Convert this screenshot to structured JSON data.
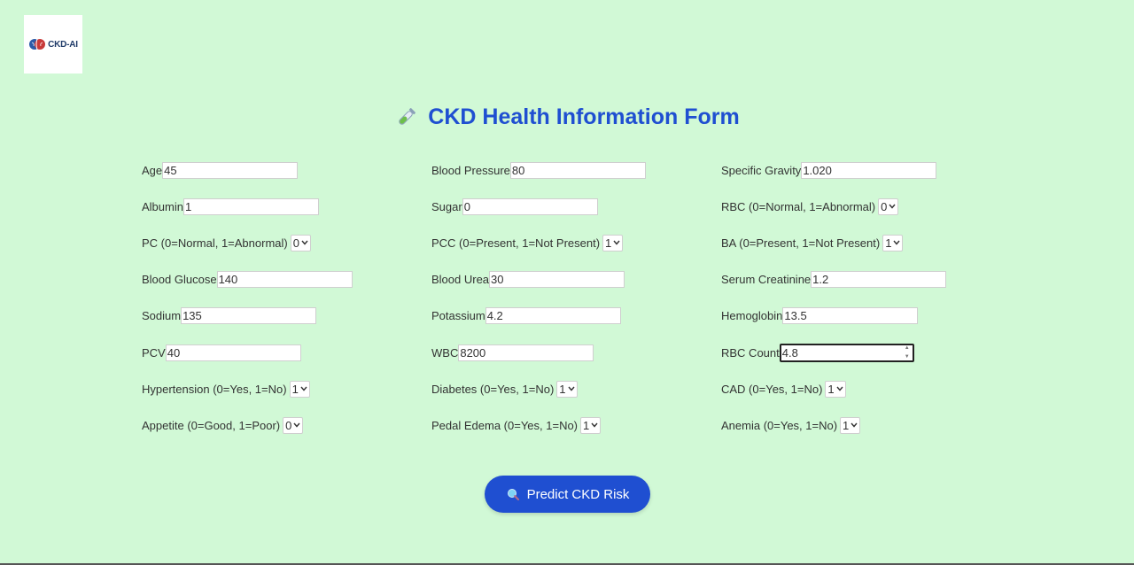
{
  "logo": {
    "text": "CKD-AI"
  },
  "title": "CKD Health Information Form",
  "fields": {
    "age": {
      "label": "Age",
      "value": "45"
    },
    "blood_pressure": {
      "label": "Blood Pressure",
      "value": "80"
    },
    "specific_gravity": {
      "label": "Specific Gravity",
      "value": "1.020"
    },
    "albumin": {
      "label": "Albumin",
      "value": "1"
    },
    "sugar": {
      "label": "Sugar",
      "value": "0"
    },
    "rbc": {
      "label": "RBC (0=Normal, 1=Abnormal)",
      "value": "0"
    },
    "pc": {
      "label": "PC (0=Normal, 1=Abnormal)",
      "value": "0"
    },
    "pcc": {
      "label": "PCC (0=Present, 1=Not Present)",
      "value": "1"
    },
    "ba": {
      "label": "BA (0=Present, 1=Not Present)",
      "value": "1"
    },
    "blood_glucose": {
      "label": "Blood Glucose",
      "value": "140"
    },
    "blood_urea": {
      "label": "Blood Urea",
      "value": "30"
    },
    "serum_creatinine": {
      "label": "Serum Creatinine",
      "value": "1.2"
    },
    "sodium": {
      "label": "Sodium",
      "value": "135"
    },
    "potassium": {
      "label": "Potassium",
      "value": "4.2"
    },
    "hemoglobin": {
      "label": "Hemoglobin",
      "value": "13.5"
    },
    "pcv": {
      "label": "PCV",
      "value": "40"
    },
    "wbc": {
      "label": "WBC",
      "value": "8200"
    },
    "rbc_count": {
      "label": "RBC Count",
      "value": "4.8"
    },
    "hypertension": {
      "label": "Hypertension (0=Yes, 1=No)",
      "value": "1"
    },
    "diabetes": {
      "label": "Diabetes (0=Yes, 1=No)",
      "value": "1"
    },
    "cad": {
      "label": "CAD (0=Yes, 1=No)",
      "value": "1"
    },
    "appetite": {
      "label": "Appetite (0=Good, 1=Poor)",
      "value": "0"
    },
    "pedal_edema": {
      "label": "Pedal Edema (0=Yes, 1=No)",
      "value": "1"
    },
    "anemia": {
      "label": "Anemia (0=Yes, 1=No)",
      "value": "1"
    }
  },
  "submit": {
    "label": "Predict CKD Risk"
  },
  "icons": {
    "title": "test-tube-icon",
    "button": "magnifier-icon",
    "logo": "brain-icon"
  },
  "colors": {
    "background": "#d1f9d6",
    "accent": "#1f4fd1"
  }
}
